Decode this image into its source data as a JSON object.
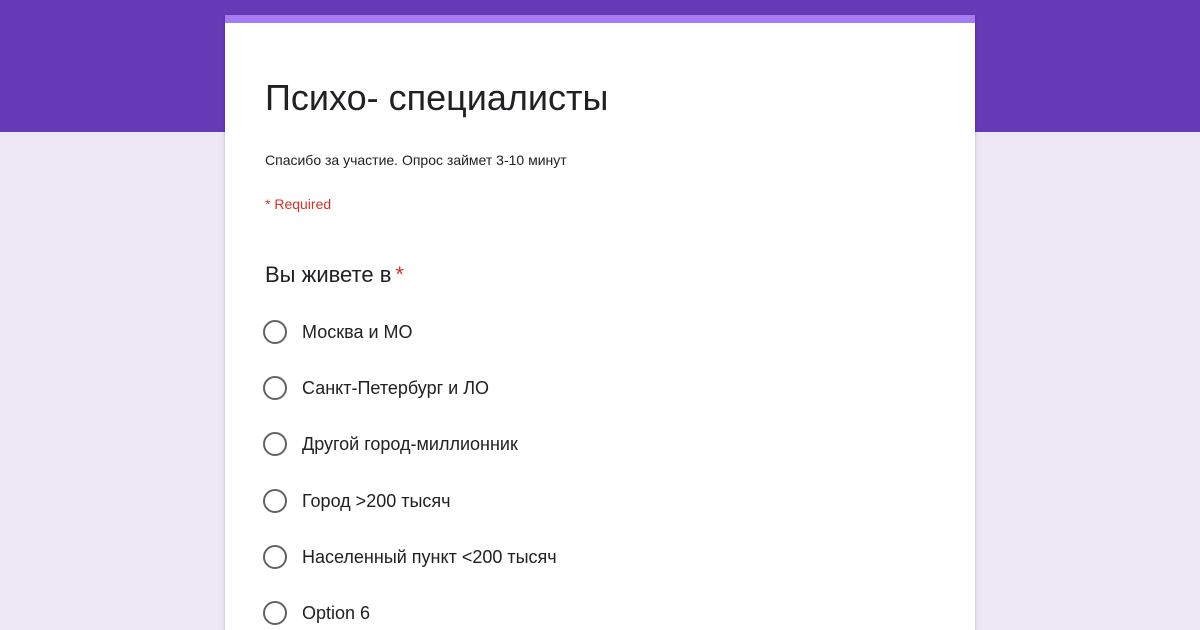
{
  "theme": {
    "header_color": "#673ab7",
    "accent_color": "#a67cf3",
    "background_color": "#ede7f6",
    "required_color": "#d93025"
  },
  "form": {
    "title": "Психо- специалисты",
    "description": "Спасибо за участие. Опрос займет 3-10 минут",
    "required_note": "* Required"
  },
  "question": {
    "title": "Вы живете в",
    "required_marker": "*",
    "options": [
      {
        "label": "Москва и МО",
        "selected": false
      },
      {
        "label": "Санкт-Петербург и ЛО",
        "selected": false
      },
      {
        "label": "Другой город-миллионник",
        "selected": false
      },
      {
        "label": "Город >200 тысяч",
        "selected": false
      },
      {
        "label": "Населенный пункт <200 тысяч",
        "selected": false
      },
      {
        "label": "Option 6",
        "selected": false
      }
    ]
  }
}
